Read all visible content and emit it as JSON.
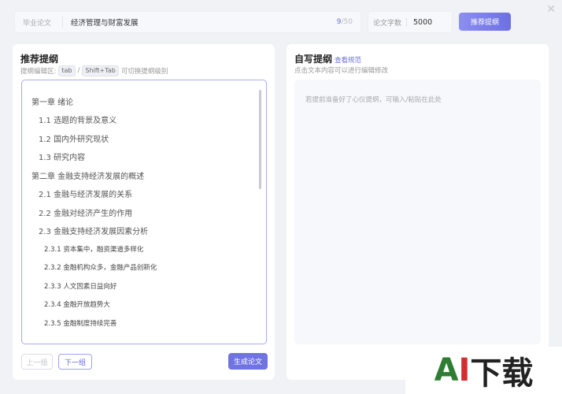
{
  "topbar": {
    "thesis_label": "毕业论文",
    "thesis_title": "经济管理与财富发展",
    "char_count_current": "9",
    "char_count_max": "/50",
    "word_count_label": "论文字数",
    "word_count_value": "5000",
    "recommend_button": "推荐提纲",
    "close_icon": "close-icon"
  },
  "left_panel": {
    "title": "推荐提纲",
    "subtitle_prefix": "提纲编辑区:",
    "key_tab": "tab",
    "key_sep": "/",
    "key_shift_tab": "Shift+Tab",
    "subtitle_suffix": "可切换提纲级别",
    "outline": [
      {
        "level": 1,
        "text": "第一章 绪论"
      },
      {
        "level": 2,
        "text": "1.1 选题的背景及意义"
      },
      {
        "level": 2,
        "text": "1.2 国内外研究现状"
      },
      {
        "level": 2,
        "text": "1.3 研究内容"
      },
      {
        "level": 1,
        "text": "第二章 金融支持经济发展的概述"
      },
      {
        "level": 2,
        "text": "2.1 金融与经济发展的关系"
      },
      {
        "level": 2,
        "text": "2.2 金融对经济产生的作用"
      },
      {
        "level": 2,
        "text": "2.3 金融支持经济发展因素分析"
      },
      {
        "level": 3,
        "text": "2.3.1 资本集中，融资渠道多样化"
      },
      {
        "level": 3,
        "text": "2.3.2 金融机构众多，金融产品创新化"
      },
      {
        "level": 3,
        "text": "2.3.3 人文因素日益向好"
      },
      {
        "level": 3,
        "text": "2.3.4 金融开放趋势大"
      },
      {
        "level": 3,
        "text": "2.3.5 金融制度持续完善"
      }
    ],
    "prev_button": "上一组",
    "next_button": "下一组",
    "generate_button": "生成论文"
  },
  "right_panel": {
    "title": "自写提纲",
    "guide_link": "查看规范",
    "subtitle": "点击文本内容可以进行编辑修改",
    "placeholder": "若提前准备好了心仪提纲，可输入/粘贴在此处"
  },
  "watermark": {
    "a": "A",
    "i": "I",
    "rest": "下载"
  }
}
